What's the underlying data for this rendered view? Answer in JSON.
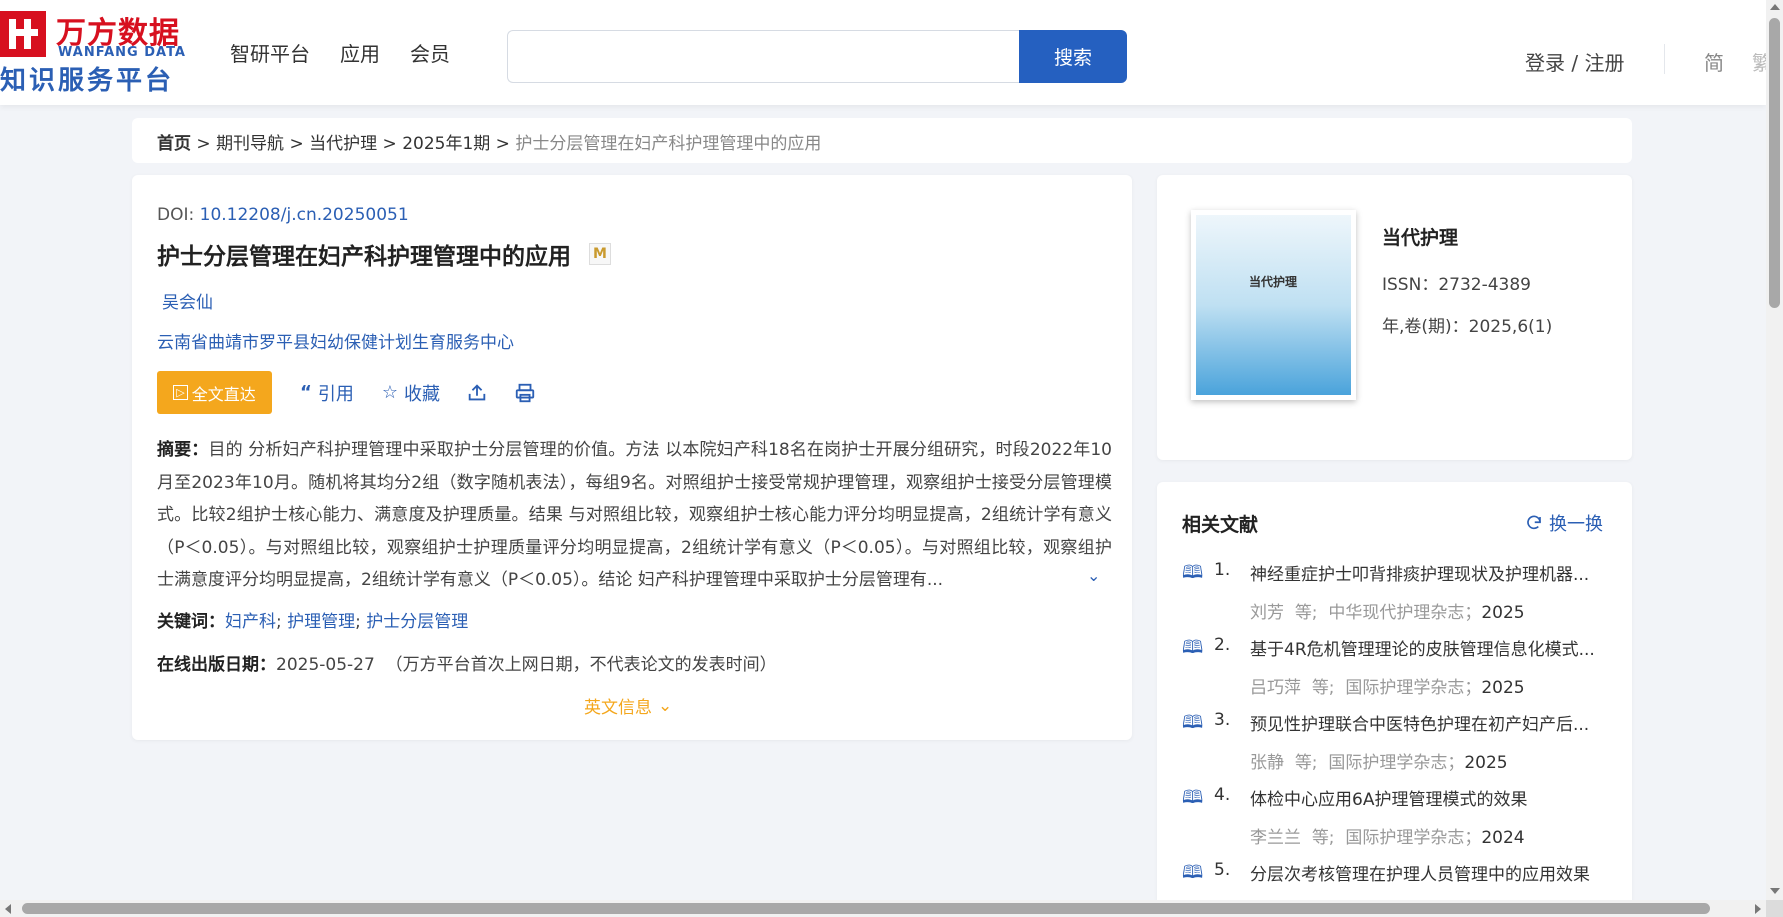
{
  "brand": {
    "name_cn": "万方数据",
    "name_en": "WANFANG DATA",
    "subtitle": "知识服务平台",
    "color": "#d7101f",
    "accent": "#2b5fb4"
  },
  "nav": [
    "智研平台",
    "应用",
    "会员"
  ],
  "search": {
    "placeholder": "",
    "button_label": "搜索",
    "button_color": "#2560c0"
  },
  "user": {
    "login_label": "登录 / 注册",
    "lang_simplified": "简",
    "lang_traditional": "繁"
  },
  "breadcrumb": {
    "home": "首页",
    "sep": " > ",
    "items": [
      "期刊导航",
      "当代护理",
      "2025年1期"
    ],
    "current": "护士分层管理在妇产科护理管理中的应用"
  },
  "article": {
    "doi_label": "DOI: ",
    "doi": "10.12208/j.cn.20250051",
    "title": "护士分层管理在妇产科护理管理中的应用",
    "badge": "M",
    "author": "吴会仙",
    "organization": "云南省曲靖市罗平县妇幼保健计划生育服务中心",
    "actions": {
      "fulltext": "全文直达",
      "fulltext_color": "#f4a71d",
      "cite": "引用",
      "favorite": "收藏"
    },
    "abstract_label": "摘要：",
    "abstract": "目的 分析妇产科护理管理中采取护士分层管理的价值。方法 以本院妇产科18名在岗护士开展分组研究，时段2022年10月至2023年10月。随机将其均分2组（数字随机表法），每组9名。对照组护士接受常规护理管理，观察组护士接受分层管理模式。比较2组护士核心能力、满意度及护理质量。结果 与对照组比较，观察组护士核心能力评分均明显提高，2组统计学有意义（P＜0.05）。与对照组比较，观察组护士护理质量评分均明显提高，2组统计学有意义（P＜0.05）。与对照组比较，观察组护士满意度评分均明显提高，2组统计学有意义（P＜0.05）。结论 妇产科护理管理中采取护士分层管理有...",
    "keywords_label": "关键词：",
    "keywords": [
      "妇产科",
      "护理管理",
      "护士分层管理"
    ],
    "pubdate_label": "在线出版日期：",
    "pubdate": "2025-05-27",
    "pubdate_note": "（万方平台首次上网日期，不代表论文的发表时间）",
    "english_info": "英文信息"
  },
  "journal": {
    "cover_title": "当代护理",
    "name": "当代护理",
    "issn_label": "ISSN：",
    "issn": "2732-4389",
    "volume_label": "年,卷(期)：",
    "volume": "2025,6(1)"
  },
  "related": {
    "title": "相关文献",
    "refresh_label": "换一换",
    "items": [
      {
        "num": "1.",
        "title": "神经重症护士叩背排痰护理现状及护理机器...",
        "authors": "刘芳",
        "et_al": "等;",
        "journal": "中华现代护理杂志；",
        "year": "2025"
      },
      {
        "num": "2.",
        "title": "基于4R危机管理理论的皮肤管理信息化模式...",
        "authors": "吕巧萍",
        "et_al": "等;",
        "journal": "国际护理学杂志；",
        "year": "2025"
      },
      {
        "num": "3.",
        "title": "预见性护理联合中医特色护理在初产妇产后...",
        "authors": "张静",
        "et_al": "等;",
        "journal": "国际护理学杂志；",
        "year": "2025"
      },
      {
        "num": "4.",
        "title": "体检中心应用6A护理管理模式的效果",
        "authors": "李兰兰",
        "et_al": "等;",
        "journal": "国际护理学杂志；",
        "year": "2024"
      },
      {
        "num": "5.",
        "title": "分层次考核管理在护理人员管理中的应用效果",
        "authors": "",
        "et_al": "",
        "journal": "",
        "year": ""
      }
    ]
  },
  "icons": {
    "quote": "quote-icon",
    "star": "star-icon",
    "share": "share-icon",
    "print": "print-icon",
    "book": "book-icon",
    "refresh": "refresh-icon",
    "chevron": "chevron-double-down-icon"
  }
}
